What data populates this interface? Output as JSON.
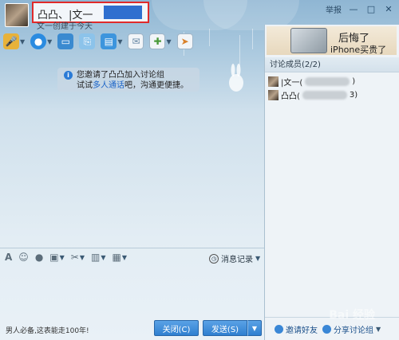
{
  "header": {
    "title": "凸凸、|文一",
    "subtitle": "文一创建于今天",
    "report_label": "举报"
  },
  "toolbar": {
    "icons": [
      "microphone-icon",
      "video-icon",
      "screen-share-icon",
      "file-transfer-icon",
      "folder-icon",
      "mail-icon",
      "app-icon",
      "exit-icon"
    ]
  },
  "notice": {
    "line1": "您邀请了凸凸加入讨论组",
    "line2_prefix": "试试",
    "line2_link": "多人通话",
    "line2_suffix": "吧，沟通更便捷。"
  },
  "input_toolbar": {
    "history_label": "消息记录"
  },
  "footer": {
    "motto": "男人必备,这表能走100年!",
    "close_label": "关闭(C)",
    "send_label": "发送(S)"
  },
  "ad": {
    "line1": "后悔了",
    "line2": "iPhone买贵了"
  },
  "members": {
    "header": "讨论成员(2/2)",
    "items": [
      {
        "name": "|文一(",
        "suffix": ")"
      },
      {
        "name": "凸凸(",
        "suffix": "3)"
      }
    ]
  },
  "right_bottom": {
    "invite_label": "邀请好友",
    "share_label": "分享讨论组"
  },
  "watermark": "Bai 经验"
}
